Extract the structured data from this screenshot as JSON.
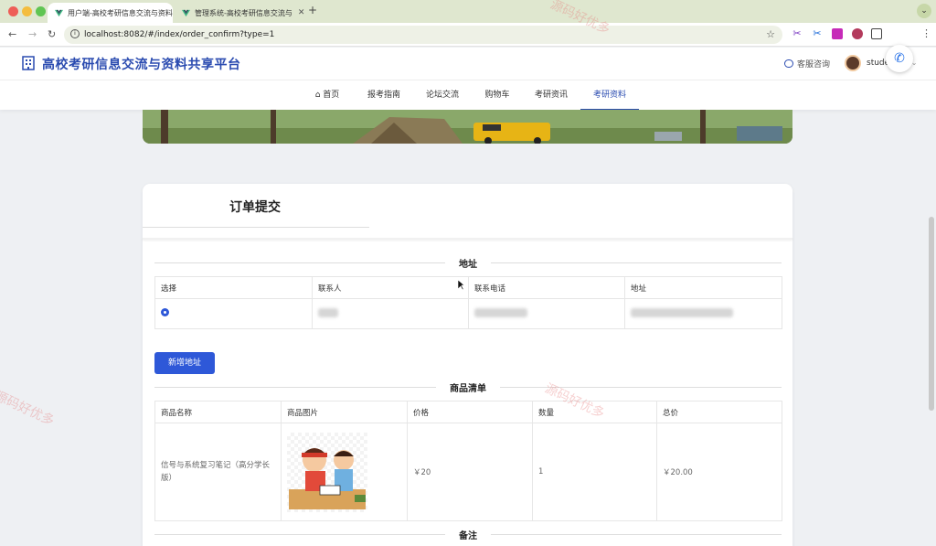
{
  "browser": {
    "tabs": [
      {
        "title": "用户端-高校考研信息交流与资料",
        "active": true
      },
      {
        "title": "管理系统-高校考研信息交流与",
        "active": false
      }
    ],
    "new_tab_label": "+",
    "url": "localhost:8082/#/index/order_confirm?type=1"
  },
  "site": {
    "title": "高校考研信息交流与资料共享平台",
    "consult_label": "客服咨询",
    "username": "student01"
  },
  "nav": {
    "items": [
      {
        "label": "首页",
        "active": false
      },
      {
        "label": "报考指南",
        "active": false
      },
      {
        "label": "论坛交流",
        "active": false
      },
      {
        "label": "购物车",
        "active": false
      },
      {
        "label": "考研资讯",
        "active": false
      },
      {
        "label": "考研资料",
        "active": true
      }
    ]
  },
  "order": {
    "title": "订单提交",
    "address_section": "地址",
    "address_headers": [
      "选择",
      "联系人",
      "联系电话",
      "地址"
    ],
    "add_address_label": "新增地址",
    "goods_section": "商品清单",
    "goods_headers": [
      "商品名称",
      "商品图片",
      "价格",
      "数量",
      "总价"
    ],
    "goods_rows": [
      {
        "name": "信号与系统复习笔记（高分学长版）",
        "price": "￥20",
        "qty": "1",
        "total": "￥20.00"
      }
    ],
    "remark_section": "备注"
  },
  "watermark": "源码好优多",
  "colors": {
    "accent": "#2e58d8",
    "brand": "#2a4bb0"
  }
}
